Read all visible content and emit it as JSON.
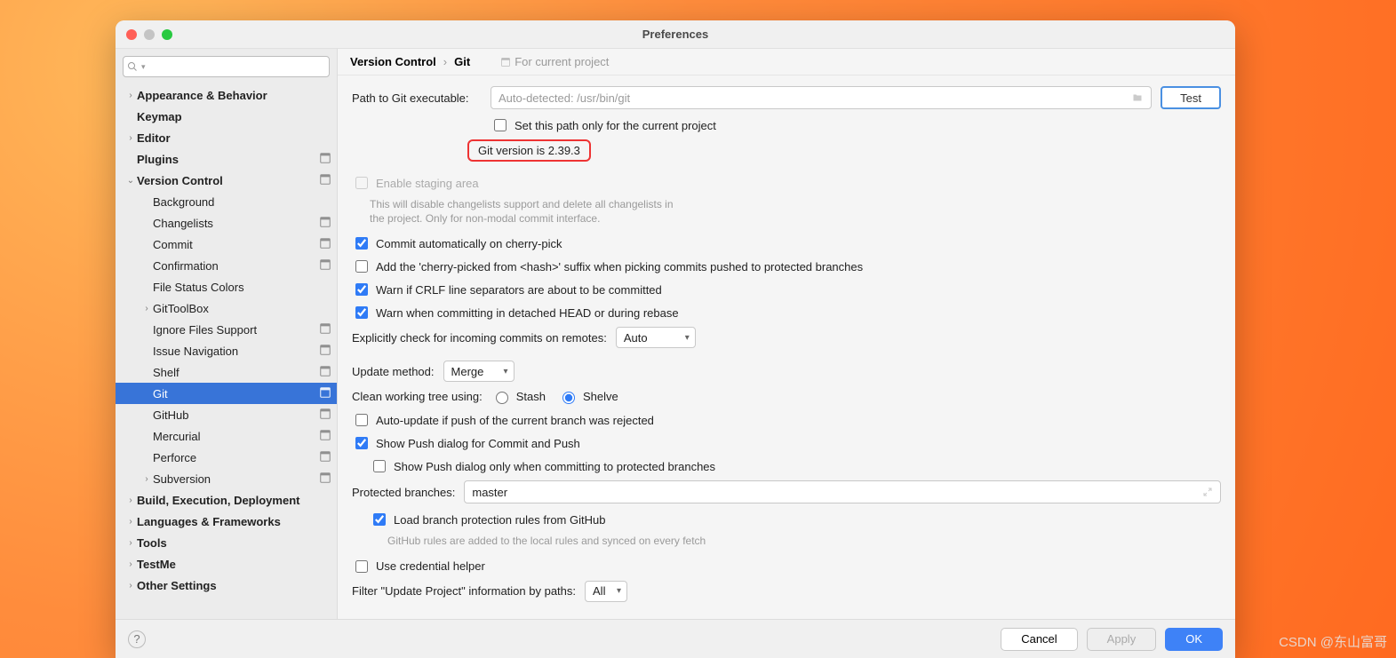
{
  "window": {
    "title": "Preferences"
  },
  "search": {
    "placeholder": "Q▾"
  },
  "sidebar": {
    "items": [
      {
        "label": "Appearance & Behavior",
        "level": 0,
        "arrow": "›",
        "bold": true,
        "proj": false
      },
      {
        "label": "Keymap",
        "level": 0,
        "arrow": "",
        "bold": true,
        "proj": false
      },
      {
        "label": "Editor",
        "level": 0,
        "arrow": "›",
        "bold": true,
        "proj": false
      },
      {
        "label": "Plugins",
        "level": 0,
        "arrow": "",
        "bold": true,
        "proj": true
      },
      {
        "label": "Version Control",
        "level": 0,
        "arrow": "⌄",
        "bold": true,
        "proj": true
      },
      {
        "label": "Background",
        "level": 1,
        "arrow": "",
        "bold": false,
        "proj": false
      },
      {
        "label": "Changelists",
        "level": 1,
        "arrow": "",
        "bold": false,
        "proj": true
      },
      {
        "label": "Commit",
        "level": 1,
        "arrow": "",
        "bold": false,
        "proj": true
      },
      {
        "label": "Confirmation",
        "level": 1,
        "arrow": "",
        "bold": false,
        "proj": true
      },
      {
        "label": "File Status Colors",
        "level": 1,
        "arrow": "",
        "bold": false,
        "proj": false
      },
      {
        "label": "GitToolBox",
        "level": 1,
        "arrow": "›",
        "bold": false,
        "proj": false
      },
      {
        "label": "Ignore Files Support",
        "level": 1,
        "arrow": "",
        "bold": false,
        "proj": true
      },
      {
        "label": "Issue Navigation",
        "level": 1,
        "arrow": "",
        "bold": false,
        "proj": true
      },
      {
        "label": "Shelf",
        "level": 1,
        "arrow": "",
        "bold": false,
        "proj": true
      },
      {
        "label": "Git",
        "level": 1,
        "arrow": "",
        "bold": false,
        "proj": true,
        "selected": true
      },
      {
        "label": "GitHub",
        "level": 1,
        "arrow": "",
        "bold": false,
        "proj": true
      },
      {
        "label": "Mercurial",
        "level": 1,
        "arrow": "",
        "bold": false,
        "proj": true
      },
      {
        "label": "Perforce",
        "level": 1,
        "arrow": "",
        "bold": false,
        "proj": true
      },
      {
        "label": "Subversion",
        "level": 1,
        "arrow": "›",
        "bold": false,
        "proj": true
      },
      {
        "label": "Build, Execution, Deployment",
        "level": 0,
        "arrow": "›",
        "bold": true,
        "proj": false
      },
      {
        "label": "Languages & Frameworks",
        "level": 0,
        "arrow": "›",
        "bold": true,
        "proj": false
      },
      {
        "label": "Tools",
        "level": 0,
        "arrow": "›",
        "bold": true,
        "proj": false
      },
      {
        "label": "TestMe",
        "level": 0,
        "arrow": "›",
        "bold": true,
        "proj": false
      },
      {
        "label": "Other Settings",
        "level": 0,
        "arrow": "›",
        "bold": true,
        "proj": false
      }
    ]
  },
  "breadcrumb": {
    "root": "Version Control",
    "leaf": "Git",
    "hint": "For current project"
  },
  "form": {
    "path_label": "Path to Git executable:",
    "path_value": "Auto-detected: /usr/bin/git",
    "test_label": "Test",
    "set_path_only": "Set this path only for the current project",
    "version_text": "Git version is 2.39.3",
    "enable_staging": "Enable staging area",
    "enable_staging_note": "This will disable changelists support and delete all changelists in the project. Only for non-modal commit interface.",
    "commit_auto": "Commit automatically on cherry-pick",
    "add_suffix": "Add the 'cherry-picked from <hash>' suffix when picking commits pushed to protected branches",
    "warn_crlf": "Warn if CRLF line separators are about to be committed",
    "warn_detached": "Warn when committing in detached HEAD or during rebase",
    "explicit_check_label": "Explicitly check for incoming commits on remotes:",
    "explicit_check_value": "Auto",
    "update_method_label": "Update method:",
    "update_method_value": "Merge",
    "clean_tree_label": "Clean working tree using:",
    "clean_stash": "Stash",
    "clean_shelve": "Shelve",
    "auto_update": "Auto-update if push of the current branch was rejected",
    "show_push": "Show Push dialog for Commit and Push",
    "show_push_protected": "Show Push dialog only when committing to protected branches",
    "protected_label": "Protected branches:",
    "protected_value": "master",
    "load_protection": "Load branch protection rules from GitHub",
    "load_protection_note": "GitHub rules are added to the local rules and synced on every fetch",
    "use_cred": "Use credential helper",
    "filter_label": "Filter \"Update Project\" information by paths:",
    "filter_value": "All"
  },
  "footer": {
    "cancel": "Cancel",
    "apply": "Apply",
    "ok": "OK"
  },
  "watermark": "CSDN @东山富哥"
}
